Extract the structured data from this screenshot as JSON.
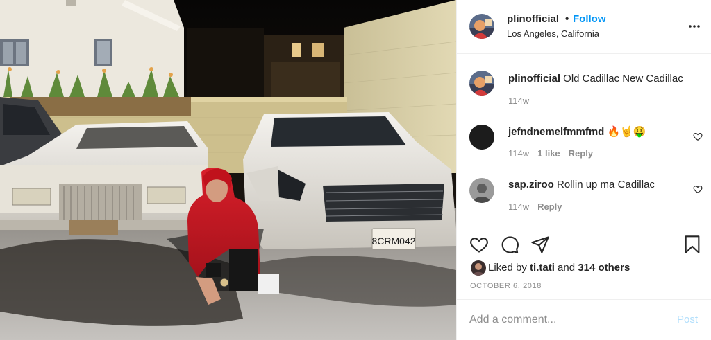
{
  "post": {
    "username": "plinofficial",
    "separator": "•",
    "follow_label": "Follow",
    "location": "Los Angeles, California",
    "more_icon": "more-horizontal-icon"
  },
  "comments": [
    {
      "username": "plinofficial",
      "text": " Old Cadillac New Cadillac",
      "time": "114w",
      "likes": "",
      "reply": ""
    },
    {
      "username": "jefndnemelfmmfmd",
      "text": " 🔥🤘🤑",
      "time": "114w",
      "likes": "1 like",
      "reply": "Reply"
    },
    {
      "username": "sap.ziroo",
      "text": " Rollin up ma Cadillac",
      "time": "114w",
      "likes": "",
      "reply": "Reply"
    }
  ],
  "actions": {
    "like_icon": "heart-icon",
    "comment_icon": "comment-icon",
    "share_icon": "share-icon",
    "save_icon": "bookmark-icon"
  },
  "likes": {
    "prefix": "Liked by ",
    "user": "ti.tati",
    "middle": " and ",
    "others": "314 others"
  },
  "date": "OCTOBER 6, 2018",
  "add_comment": {
    "placeholder": "Add a comment...",
    "post_label": "Post"
  },
  "photo": {
    "license_plate": "8CRM042"
  },
  "colors": {
    "accent": "#0095f6",
    "post_disabled": "#b2dffc",
    "muted": "#8e8e8e"
  }
}
